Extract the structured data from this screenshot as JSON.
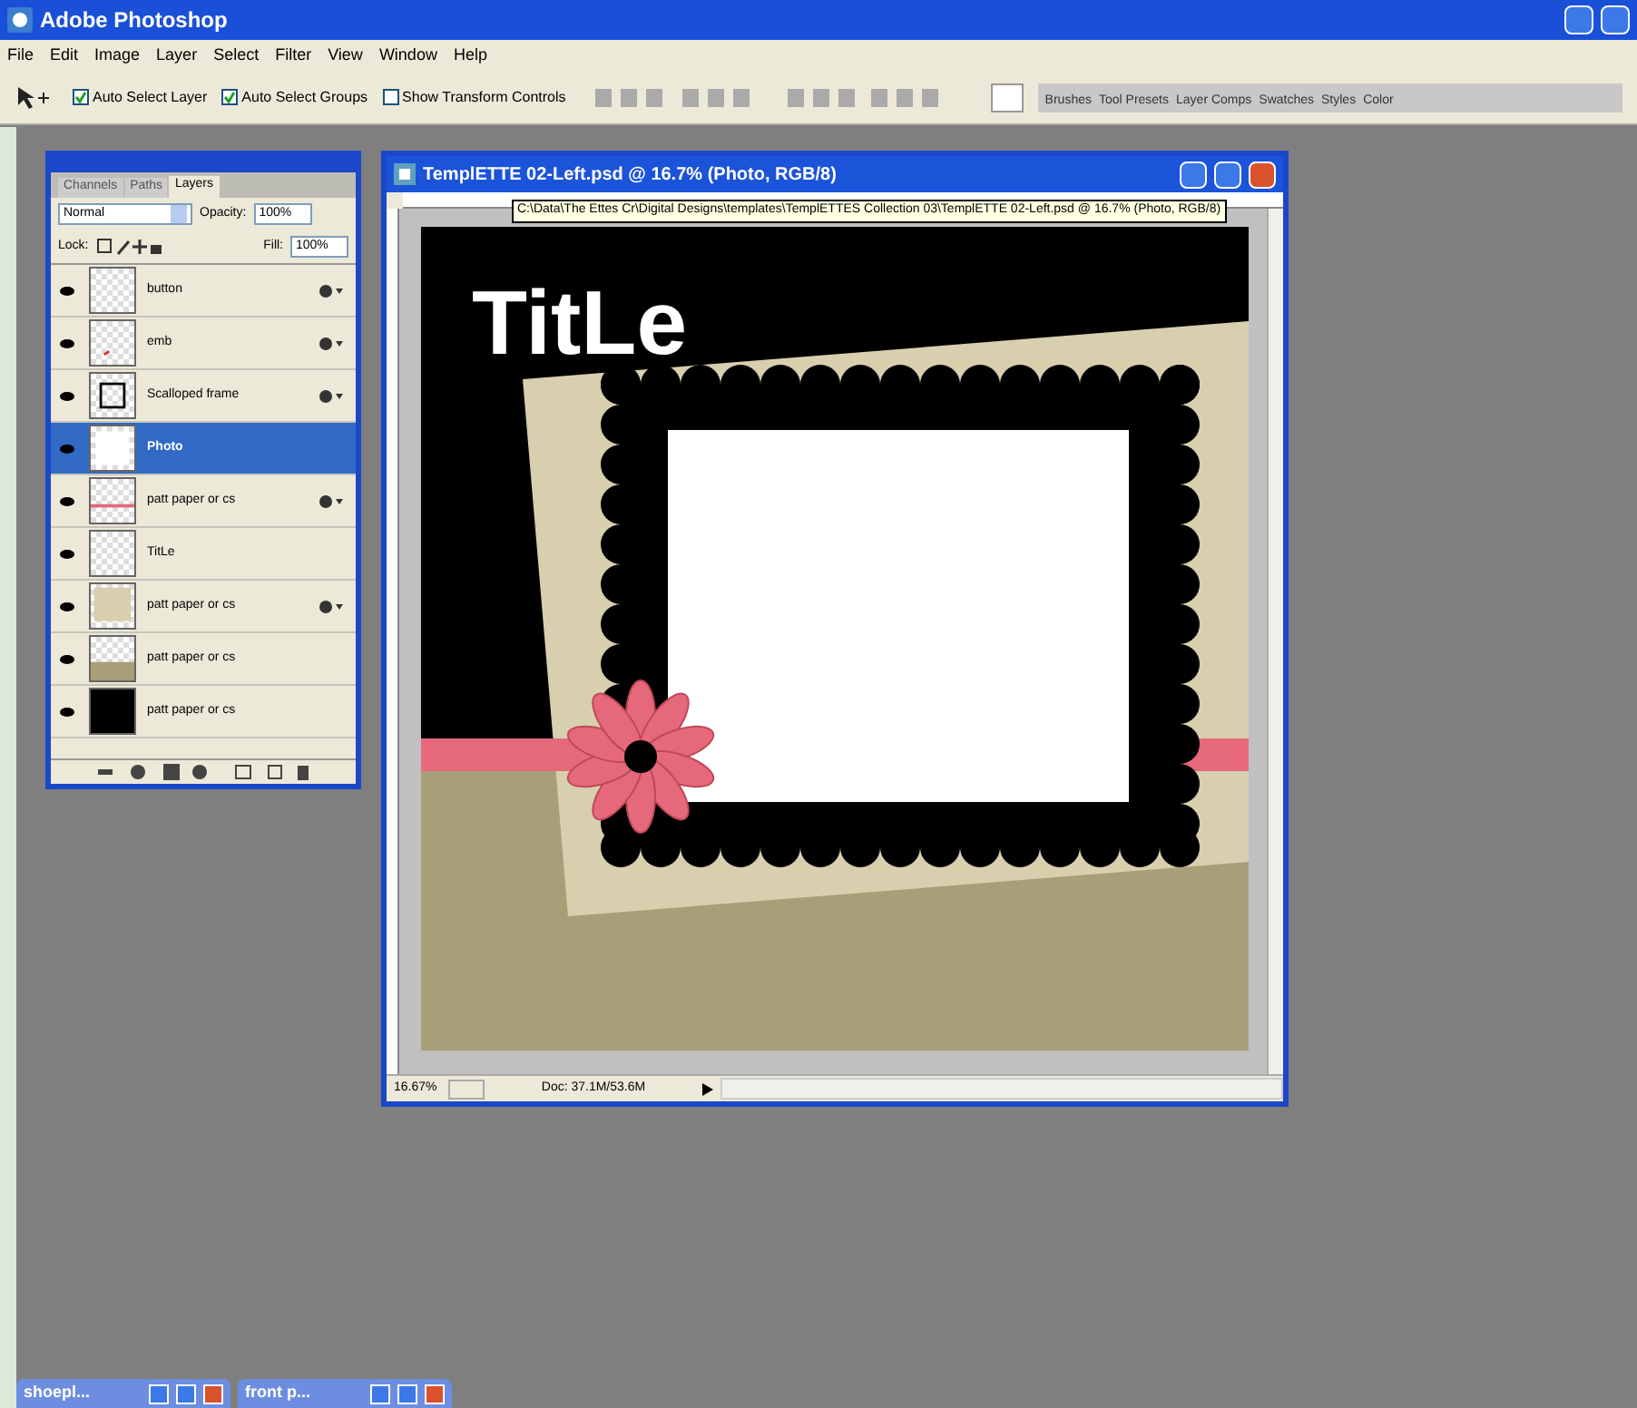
{
  "window": {
    "title": "Adobe Photoshop"
  },
  "menu": [
    "File",
    "Edit",
    "Image",
    "Layer",
    "Select",
    "Filter",
    "View",
    "Window",
    "Help"
  ],
  "options_bar": {
    "checkboxes": [
      {
        "label": "Auto Select Layer",
        "checked": true
      },
      {
        "label": "Auto Select Groups",
        "checked": true
      },
      {
        "label": "Show Transform Controls",
        "checked": false
      }
    ],
    "palette_tabs": [
      "Brushes",
      "Tool Presets",
      "Layer Comps",
      "Swatches",
      "Styles",
      "Color"
    ]
  },
  "layers_panel": {
    "tabs": [
      {
        "label": "Channels",
        "selected": false
      },
      {
        "label": "Paths",
        "selected": false
      },
      {
        "label": "Layers",
        "selected": true
      }
    ],
    "blend_mode": "Normal",
    "opacity_label": "Opacity:",
    "opacity": "100%",
    "lock_label": "Lock:",
    "fill_label": "Fill:",
    "fill": "100%",
    "layers": [
      {
        "name": "button",
        "selected": false,
        "visible": true,
        "effects": true,
        "kind": "empty"
      },
      {
        "name": "emb",
        "selected": false,
        "visible": true,
        "effects": true,
        "kind": "mark"
      },
      {
        "name": "Scalloped frame",
        "selected": false,
        "visible": true,
        "effects": true,
        "kind": "frame"
      },
      {
        "name": "Photo",
        "selected": true,
        "visible": true,
        "effects": false,
        "kind": "white"
      },
      {
        "name": "patt paper or cs",
        "selected": false,
        "visible": true,
        "effects": true,
        "kind": "ribbon"
      },
      {
        "name": "TitLe",
        "selected": false,
        "visible": true,
        "effects": false,
        "kind": "empty"
      },
      {
        "name": "patt paper or cs",
        "selected": false,
        "visible": true,
        "effects": true,
        "kind": "beige"
      },
      {
        "name": "patt paper or cs",
        "selected": false,
        "visible": true,
        "effects": false,
        "kind": "tan"
      },
      {
        "name": "patt paper or cs",
        "selected": false,
        "visible": true,
        "effects": false,
        "kind": "black"
      }
    ]
  },
  "document": {
    "title": "TemplETTE 02-Left.psd @ 16.7% (Photo, RGB/8)",
    "tooltip": "C:\\Data\\The Ettes  Cr\\Digital Designs\\templates\\TemplETTES Collection 03\\TemplETTE 02-Left.psd @ 16.7% (Photo, RGB/8)",
    "canvas_title": "TitLe",
    "zoom": "16.67%",
    "doc_size": "Doc: 37.1M/53.6M"
  },
  "minimized_windows": [
    "shoepl...",
    "front p..."
  ]
}
